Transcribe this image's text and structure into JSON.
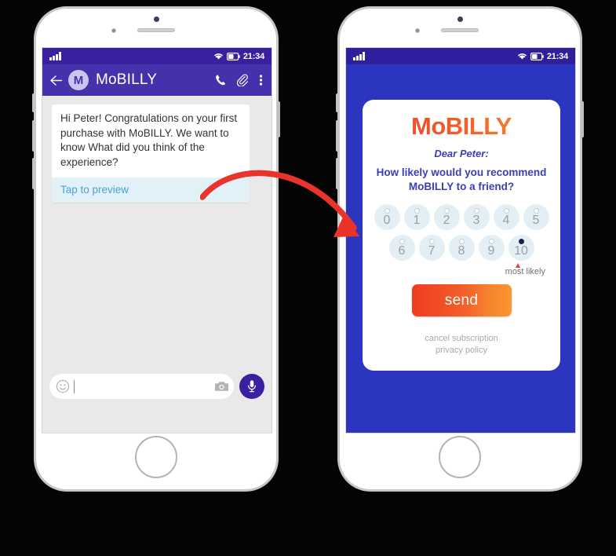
{
  "colors": {
    "page_background": "#050505",
    "statusbar_purple": "#3a1fa0",
    "appbar_purple": "#4332ac",
    "survey_blue": "#2b35c0",
    "chat_gray": "#e9e9e9",
    "preview_blue": "#e2f0f7",
    "preview_link": "#4aa0d8",
    "brand_orange_start": "#ef3b24",
    "brand_orange_end": "#f8972f",
    "arrow_red": "#e8342a",
    "rating_circle": "#e4eff5",
    "survey_text_blue": "#3b3fb5"
  },
  "phone_left": {
    "status_bar": {
      "signal_icon": "signal-bars-icon",
      "wifi_icon": "wifi-icon",
      "battery_icon": "battery-icon",
      "time": "21:34"
    },
    "app_bar": {
      "back_icon": "back-arrow-icon",
      "avatar_letter": "M",
      "title": "MoBILLY",
      "call_icon": "phone-call-icon",
      "attach_icon": "paperclip-icon",
      "overflow_icon": "overflow-menu-icon"
    },
    "message": {
      "text": "Hi Peter! Congratulations on your first purchase with MoBILLY. We want to know What did you think of the experience?",
      "preview_label": "Tap to preview"
    },
    "input_bar": {
      "emoji_icon": "emoji-smiley-icon",
      "placeholder": "",
      "value": "",
      "camera_icon": "camera-icon",
      "mic_icon": "microphone-icon"
    }
  },
  "phone_right": {
    "status_bar": {
      "signal_icon": "signal-bars-icon",
      "wifi_icon": "wifi-icon",
      "battery_icon": "battery-icon",
      "time": "21:34"
    },
    "survey": {
      "logo": "MoBILLY",
      "greeting": "Dear Peter:",
      "question": "How likely would you recommend MoBILLY to a friend?",
      "rating_row_1": [
        "0",
        "1",
        "2",
        "3",
        "4",
        "5"
      ],
      "rating_row_2": [
        "6",
        "7",
        "8",
        "9",
        "10"
      ],
      "selected_rating": "10",
      "scale_label": "most likely",
      "send_label": "send",
      "footer": {
        "cancel_subscription": "cancel subscription",
        "privacy_policy": "privacy policy"
      }
    }
  },
  "annotation": {
    "arrow_icon": "curved-red-arrow"
  }
}
